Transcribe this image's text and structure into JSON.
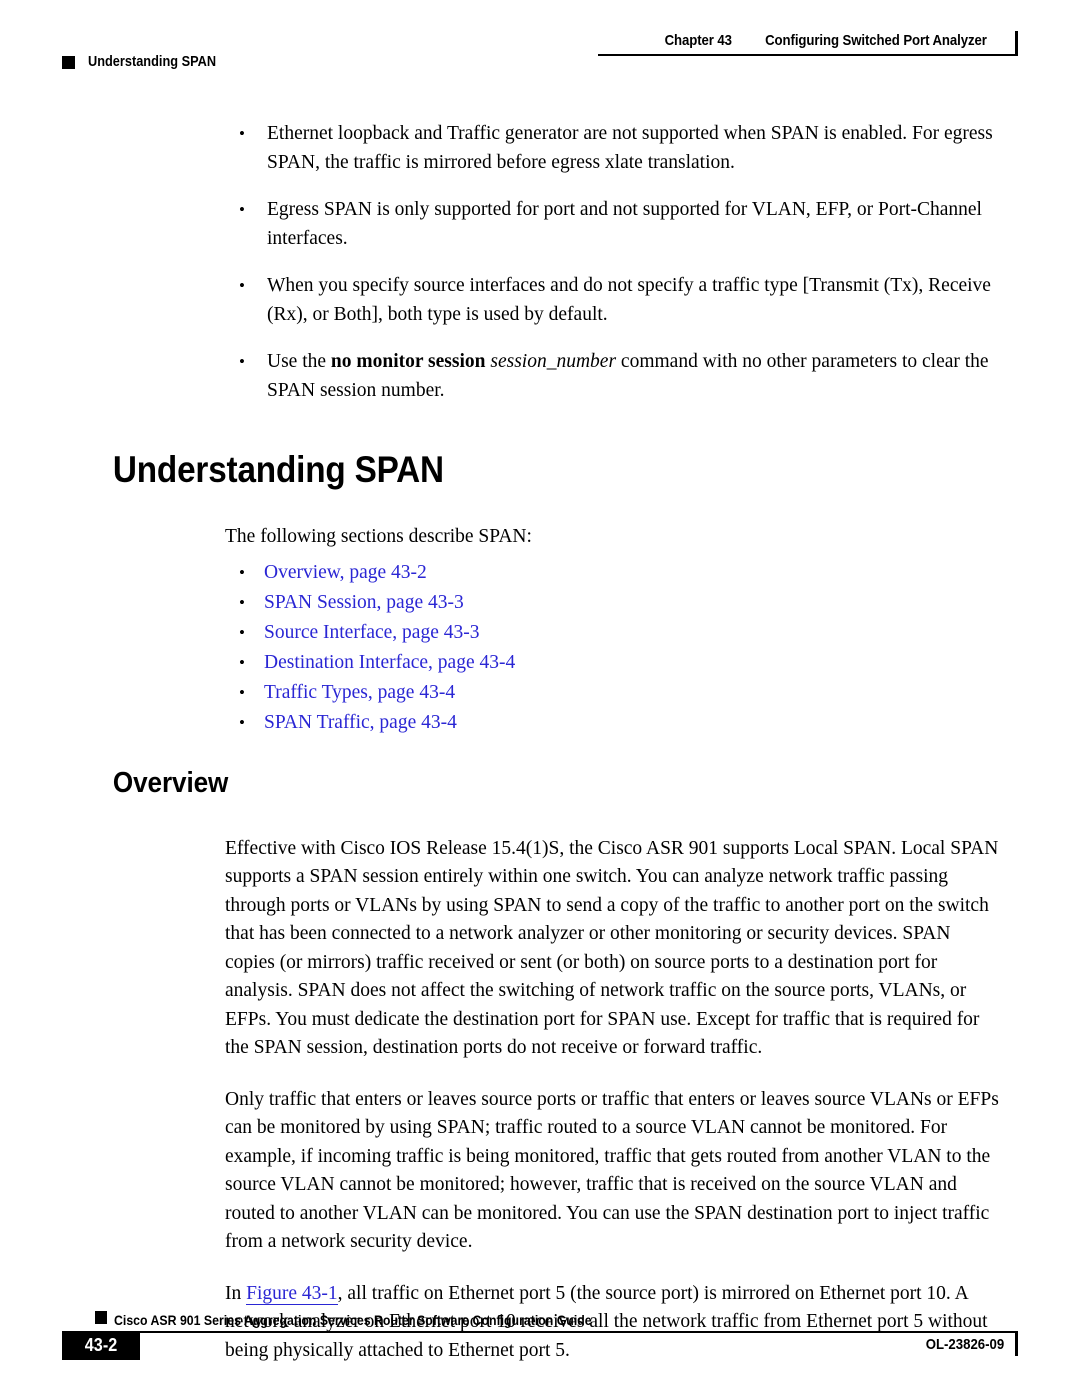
{
  "header": {
    "chapter_number": "Chapter 43",
    "chapter_title": "Configuring Switched Port Analyzer",
    "running_head_left": "Understanding SPAN"
  },
  "intro_bullets": [
    {
      "parts": [
        {
          "text": "Ethernet loopback and Traffic generator are not supported when SPAN is enabled. For egress SPAN, the traffic is mirrored before egress xlate translation.",
          "style": "normal"
        }
      ]
    },
    {
      "parts": [
        {
          "text": "Egress SPAN is only supported for port and not supported for VLAN, EFP, or Port-Channel interfaces.",
          "style": "normal"
        }
      ]
    },
    {
      "parts": [
        {
          "text": "When you specify source interfaces and do not specify a traffic type [Transmit (Tx), Receive (Rx), or Both], both type is used by default.",
          "style": "normal"
        }
      ]
    },
    {
      "parts": [
        {
          "text": "Use the ",
          "style": "normal"
        },
        {
          "text": "no monitor session",
          "style": "bold"
        },
        {
          "text": " ",
          "style": "normal"
        },
        {
          "text": "session_number",
          "style": "italic"
        },
        {
          "text": " command with no other parameters to clear the SPAN session number.",
          "style": "normal"
        }
      ]
    }
  ],
  "section_understanding_span": {
    "heading": "Understanding SPAN",
    "lead_in": "The following sections describe SPAN:",
    "links": [
      {
        "label": "Overview, page 43-2"
      },
      {
        "label": "SPAN Session, page 43-3"
      },
      {
        "label": "Source Interface, page 43-3"
      },
      {
        "label": "Destination Interface, page 43-4"
      },
      {
        "label": "Traffic Types, page 43-4"
      },
      {
        "label": "SPAN Traffic, page 43-4"
      }
    ]
  },
  "section_overview": {
    "heading": "Overview",
    "paragraph_1": "Effective with Cisco IOS Release 15.4(1)S, the Cisco ASR 901 supports Local SPAN. Local SPAN supports a SPAN session entirely within one switch. You can analyze network traffic passing through ports or VLANs by using SPAN to send a copy of the traffic to another port on the switch that has been connected to a network analyzer or other monitoring or security devices. SPAN copies (or mirrors) traffic received or sent (or both) on source ports to a destination port for analysis. SPAN does not affect the switching of network traffic on the source ports, VLANs, or EFPs. You must dedicate the destination port for SPAN use. Except for traffic that is required for the SPAN session, destination ports do not receive or forward traffic.",
    "paragraph_2": "Only traffic that enters or leaves source ports or traffic that enters or leaves source VLANs or EFPs can be monitored by using SPAN; traffic routed to a source VLAN cannot be monitored. For example, if incoming traffic is being monitored, traffic that gets routed from another VLAN to the source VLAN cannot be monitored; however, traffic that is received on the source VLAN and routed to another VLAN can be monitored. You can use the SPAN destination port to inject traffic from a network security device.",
    "paragraph_3_prefix": "In ",
    "paragraph_3_figure_link": "Figure 43-1",
    "paragraph_3_suffix": ", all traffic on Ethernet port 5 (the source port) is mirrored on Ethernet port 10. A network analyzer on Ethernet port 10 receives all the network traffic from Ethernet port 5 without being physically attached to Ethernet port 5."
  },
  "footer": {
    "book_title": "Cisco ASR 901 Series Aggregation Services Router Software Configuration Guide",
    "page_number": "43-2",
    "doc_id": "OL-23826-09"
  },
  "colors": {
    "link_blue": "#2a26d4",
    "text_black": "#000000",
    "page_background": "#ffffff"
  }
}
